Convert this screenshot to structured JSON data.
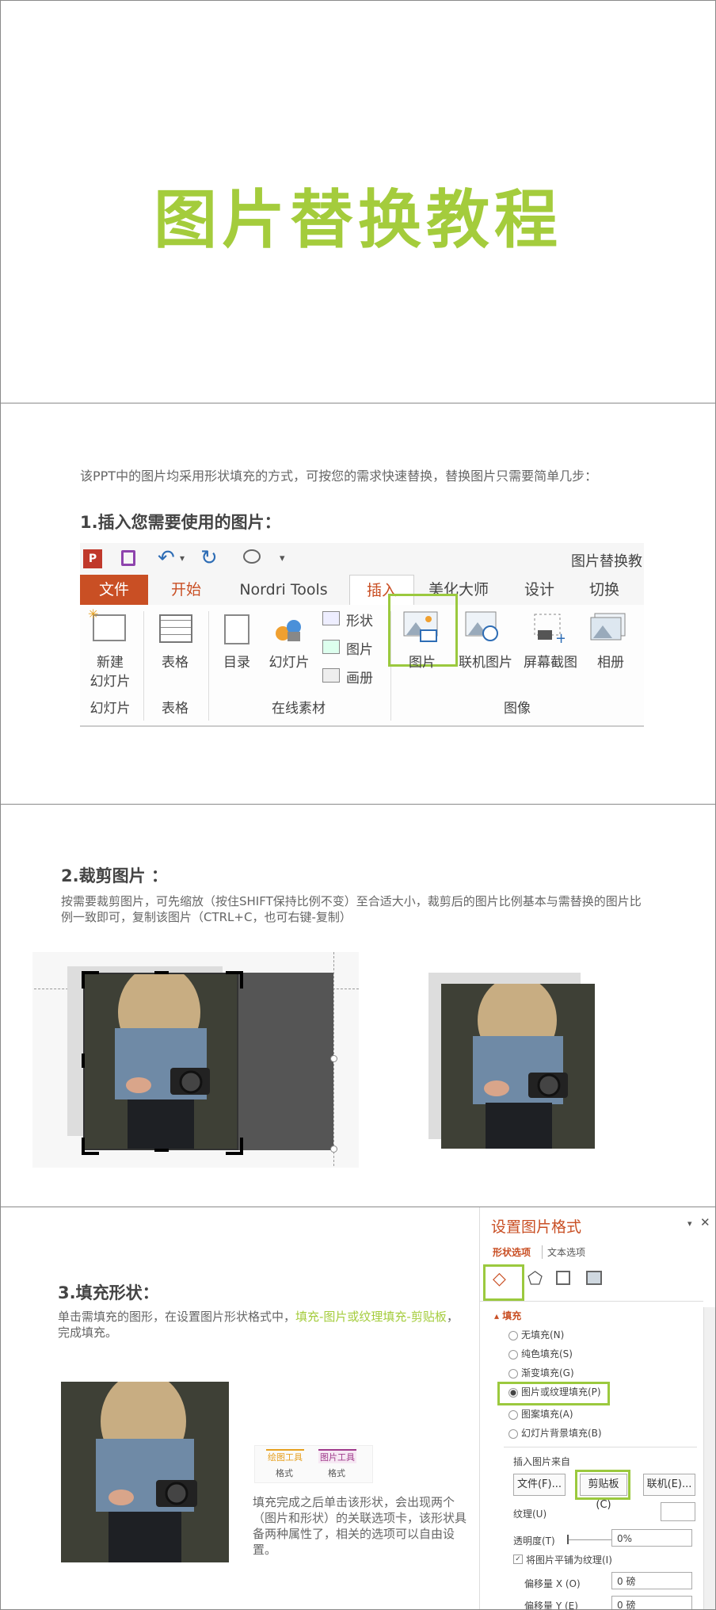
{
  "slide1": {
    "title": "图片替换教程"
  },
  "slide2": {
    "intro": "该PPT中的图片均采用形状填充的方式，可按您的需求快速替换，替换图片只需要简单几步：",
    "step": "1.插入您需要使用的图片：",
    "ribbon": {
      "doc_title": "图片替换教",
      "tabs": [
        "文件",
        "开始",
        "Nordri Tools",
        "插入",
        "美化大师",
        "设计",
        "切换"
      ],
      "buttons": {
        "new_slide": "新建",
        "new_slide2": "幻灯片",
        "table": "表格",
        "toc": "目录",
        "slides": "幻灯片",
        "shape": "形状",
        "picture_small": "图片",
        "album_small": "画册",
        "picture": "图片",
        "online_picture": "联机图片",
        "screenshot": "屏幕截图",
        "album": "相册"
      },
      "groups": [
        "幻灯片",
        "表格",
        "在线素材",
        "图像"
      ]
    }
  },
  "slide3": {
    "step": "2.裁剪图片 ：",
    "text": "按需要裁剪图片，可先缩放（按住SHIFT保持比例不变）至合适大小，裁剪后的图片比例基本与需替换的图片比例一致即可，复制该图片（CTRL+C，也可右键-复制）"
  },
  "slide4": {
    "step": "3.填充形状：",
    "text_a": "单击需填充的图形，在设置图片形状格式中，",
    "text_link": "填充-图片或纹理填充-剪贴板",
    "text_b": "，完成填充。",
    "tool_tab1": "绘图工具",
    "tool_tab2": "图片工具",
    "tool_sub1": "格式",
    "tool_sub2": "格式",
    "note": "填充完成之后单击该形状，会出现两个（图片和形状）的关联选项卡，该形状具备两种属性了，相关的选项可以自由设置。",
    "pane": {
      "title": "设置图片格式",
      "tab1": "形状选项",
      "tab2": "文本选项",
      "section": "填充",
      "options": [
        "无填充(N)",
        "纯色填充(S)",
        "渐变填充(G)",
        "图片或纹理填充(P)",
        "图案填充(A)",
        "幻灯片背景填充(B)"
      ],
      "insert_from": "插入图片来自",
      "btn_file": "文件(F)...",
      "btn_clip": "剪贴板(C)",
      "btn_online": "联机(E)...",
      "texture": "纹理(U)",
      "transparency": "透明度(T)",
      "transparency_val": "0%",
      "tile": "将图片平铺为纹理(I)",
      "offset_x": "偏移量 X (O)",
      "offset_x_val": "0 磅",
      "offset_y": "偏移量 Y (E)",
      "offset_y_val": "0 磅"
    }
  },
  "colors": {
    "green": "#a4cc3c",
    "orange": "#c94f24",
    "accent_red": "#c0392b"
  }
}
